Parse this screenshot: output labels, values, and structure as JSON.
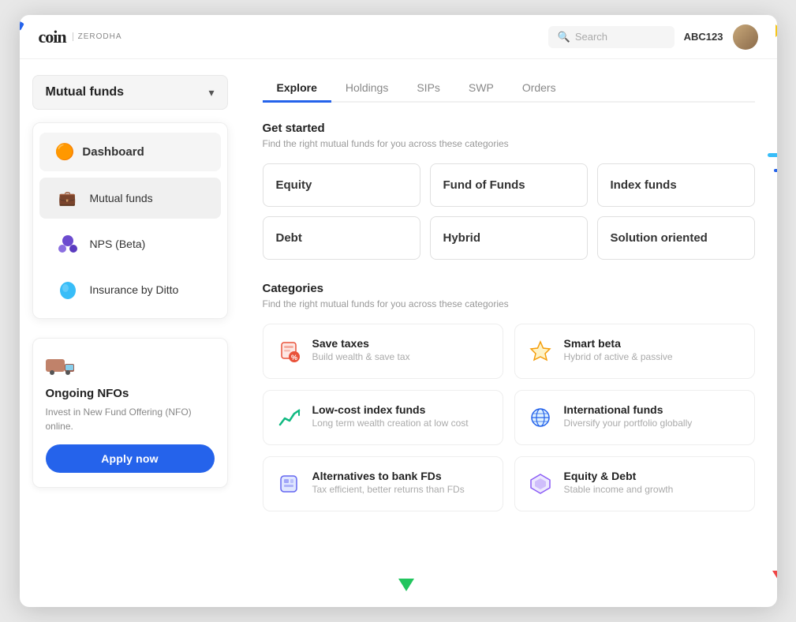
{
  "header": {
    "logo": "coin",
    "brand": "zerodha",
    "search_placeholder": "Search",
    "user_id": "ABC123"
  },
  "sidebar": {
    "dropdown_label": "Mutual funds",
    "menu_items": [
      {
        "id": "dashboard",
        "label": "Dashboard",
        "icon": "🟠"
      },
      {
        "id": "mutual-funds",
        "label": "Mutual funds",
        "icon": "💼"
      },
      {
        "id": "nps",
        "label": "NPS (Beta)",
        "icon": "🌐"
      },
      {
        "id": "insurance",
        "label": "Insurance by Ditto",
        "icon": "💧"
      }
    ],
    "nfo": {
      "title": "Ongoing NFOs",
      "desc": "Invest in New Fund Offering (NFO) online.",
      "apply_label": "Apply now",
      "icon": "🚚"
    }
  },
  "tabs": [
    {
      "id": "explore",
      "label": "Explore",
      "active": true
    },
    {
      "id": "holdings",
      "label": "Holdings",
      "active": false
    },
    {
      "id": "sips",
      "label": "SIPs",
      "active": false
    },
    {
      "id": "swp",
      "label": "SWP",
      "active": false
    },
    {
      "id": "orders",
      "label": "Orders",
      "active": false
    }
  ],
  "get_started": {
    "title": "Get started",
    "desc": "Find the right mutual funds for you across these categories",
    "funds": [
      {
        "id": "equity",
        "label": "Equity"
      },
      {
        "id": "fund-of-funds",
        "label": "Fund of Funds"
      },
      {
        "id": "index-funds",
        "label": "Index funds"
      },
      {
        "id": "debt",
        "label": "Debt"
      },
      {
        "id": "hybrid",
        "label": "Hybrid"
      },
      {
        "id": "solution-oriented",
        "label": "Solution oriented"
      }
    ]
  },
  "categories": {
    "title": "Categories",
    "desc": "Find the right mutual funds for you across these categories",
    "items": [
      {
        "id": "save-taxes",
        "icon": "🎁",
        "name": "Save taxes",
        "sub": "Build wealth & save tax",
        "icon_color": "#e9523a"
      },
      {
        "id": "smart-beta",
        "icon": "⭐",
        "name": "Smart beta",
        "sub": "Hybrid of active & passive",
        "icon_color": "#f59e0b"
      },
      {
        "id": "low-cost-index",
        "icon": "📈",
        "name": "Low-cost index funds",
        "sub": "Long term wealth creation at low cost",
        "icon_color": "#10b981"
      },
      {
        "id": "international",
        "icon": "🌐",
        "name": "International funds",
        "sub": "Diversify your portfolio globally",
        "icon_color": "#2563eb"
      },
      {
        "id": "alternatives-fd",
        "icon": "🎲",
        "name": "Alternatives to bank FDs",
        "sub": "Tax efficient, better returns than FDs",
        "icon_color": "#6366f1"
      },
      {
        "id": "equity-debt",
        "icon": "🛡️",
        "name": "Equity & Debt",
        "sub": "Stable income and growth",
        "icon_color": "#8b5cf6"
      }
    ]
  },
  "icons": {
    "search": "🔍",
    "chevron_down": "▾",
    "truck": "🚚"
  }
}
